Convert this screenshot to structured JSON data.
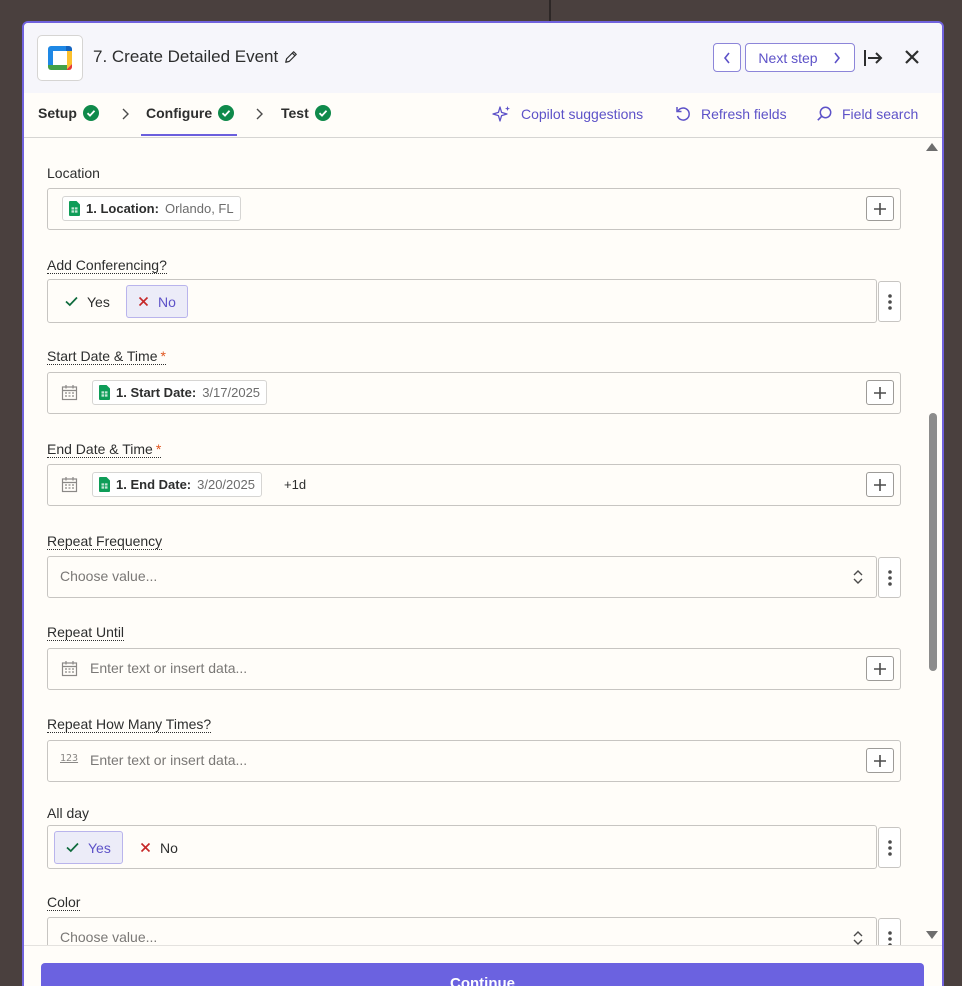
{
  "header": {
    "title": "7. Create Detailed Event",
    "next_label": "Next step"
  },
  "tabs": [
    {
      "label": "Setup"
    },
    {
      "label": "Configure"
    },
    {
      "label": "Test"
    }
  ],
  "tools": {
    "copilot": "Copilot suggestions",
    "refresh": "Refresh fields",
    "search": "Field search"
  },
  "fields": {
    "location": {
      "label": "Location",
      "pill_key": "1. Location:",
      "pill_value": "Orlando, FL"
    },
    "conferencing": {
      "label": "Add Conferencing?",
      "yes": "Yes",
      "no": "No",
      "selected": "No"
    },
    "start": {
      "label": "Start Date & Time",
      "required": "*",
      "pill_key": "1. Start Date:",
      "pill_value": "3/17/2025"
    },
    "end": {
      "label": "End Date & Time",
      "required": "*",
      "pill_key": "1. End Date:",
      "pill_value": "3/20/2025",
      "suffix": "+1d"
    },
    "repeat_frequency": {
      "label": "Repeat Frequency",
      "placeholder": "Choose value..."
    },
    "repeat_until": {
      "label": "Repeat Until",
      "placeholder": "Enter text or insert data..."
    },
    "repeat_times": {
      "label": "Repeat How Many Times?",
      "placeholder": "Enter text or insert data...",
      "icon_text": "123"
    },
    "all_day": {
      "label": "All day",
      "yes": "Yes",
      "no": "No",
      "selected": "Yes"
    },
    "color": {
      "label": "Color",
      "placeholder": "Choose value..."
    }
  },
  "footer": {
    "continue_label": "Continue"
  },
  "colors": {
    "accent": "#6b62e0",
    "success": "#0f8a4b",
    "required": "#e0551e"
  }
}
